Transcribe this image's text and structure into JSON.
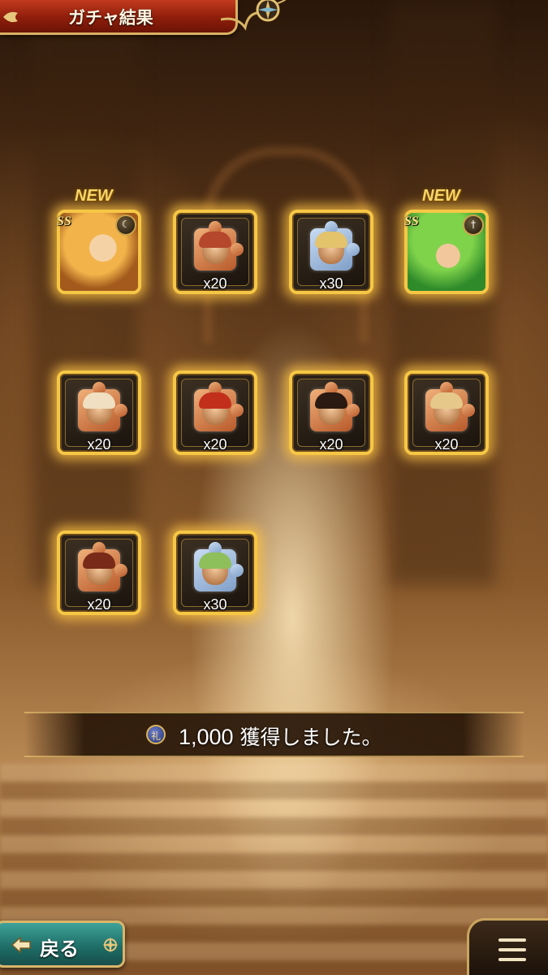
{
  "header": {
    "title": "ガチャ結果"
  },
  "rewards": [
    {
      "kind": "character",
      "new_label": "NEW",
      "rarity_label": "SS",
      "quantity": ""
    },
    {
      "kind": "fragment",
      "quantity": "x20"
    },
    {
      "kind": "fragment",
      "quantity": "x30"
    },
    {
      "kind": "character",
      "new_label": "NEW",
      "rarity_label": "SS",
      "quantity": ""
    },
    {
      "kind": "fragment",
      "quantity": "x20"
    },
    {
      "kind": "fragment",
      "quantity": "x20"
    },
    {
      "kind": "fragment",
      "quantity": "x20"
    },
    {
      "kind": "fragment",
      "quantity": "x20"
    },
    {
      "kind": "fragment",
      "quantity": "x20"
    },
    {
      "kind": "fragment",
      "quantity": "x30"
    }
  ],
  "acquired": {
    "coin_glyph": "礼",
    "amount": "1,000",
    "message": "獲得しました。"
  },
  "footer": {
    "back_label": "戻る"
  },
  "colors": {
    "glow": "#f6c745",
    "banner_red": "#8e1d0b",
    "back_teal": "#1f6f68"
  }
}
